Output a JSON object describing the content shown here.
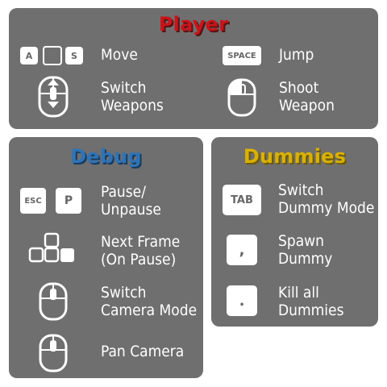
{
  "player": {
    "title": "Player",
    "move_label": "Move",
    "move_keys": [
      "A",
      "",
      "S"
    ],
    "jump_key": "SPACE",
    "jump_label": "Jump",
    "switch_weapons_label": [
      "Switch",
      "Weapons"
    ],
    "shoot_weapon_label": [
      "Shoot",
      "Weapon"
    ]
  },
  "debug": {
    "title": "Debug",
    "pause_keys": [
      "ESC",
      "P"
    ],
    "pause_label": [
      "Pause/",
      "Unpause"
    ],
    "next_frame_label": [
      "Next Frame",
      "(On Pause)"
    ],
    "switch_camera_label": [
      "Switch",
      "Camera Mode"
    ],
    "pan_camera_label": "Pan Camera"
  },
  "dummies": {
    "title": "Dummies",
    "tab_key": "TAB",
    "switch_dummy_label": [
      "Switch",
      "Dummy Mode"
    ],
    "comma_key": ",",
    "spawn_dummy_label": [
      "Spawn",
      "Dummy"
    ],
    "period_key": ".",
    "kill_dummies_label": [
      "Kill all",
      "Dummies"
    ]
  },
  "colors": {
    "panel_bg": "#6f6f6f",
    "player_title": "#c8141a",
    "debug_title": "#2f73b6",
    "dummies_title": "#d9b100",
    "key_bg": "#ffffff",
    "text": "#ffffff"
  }
}
